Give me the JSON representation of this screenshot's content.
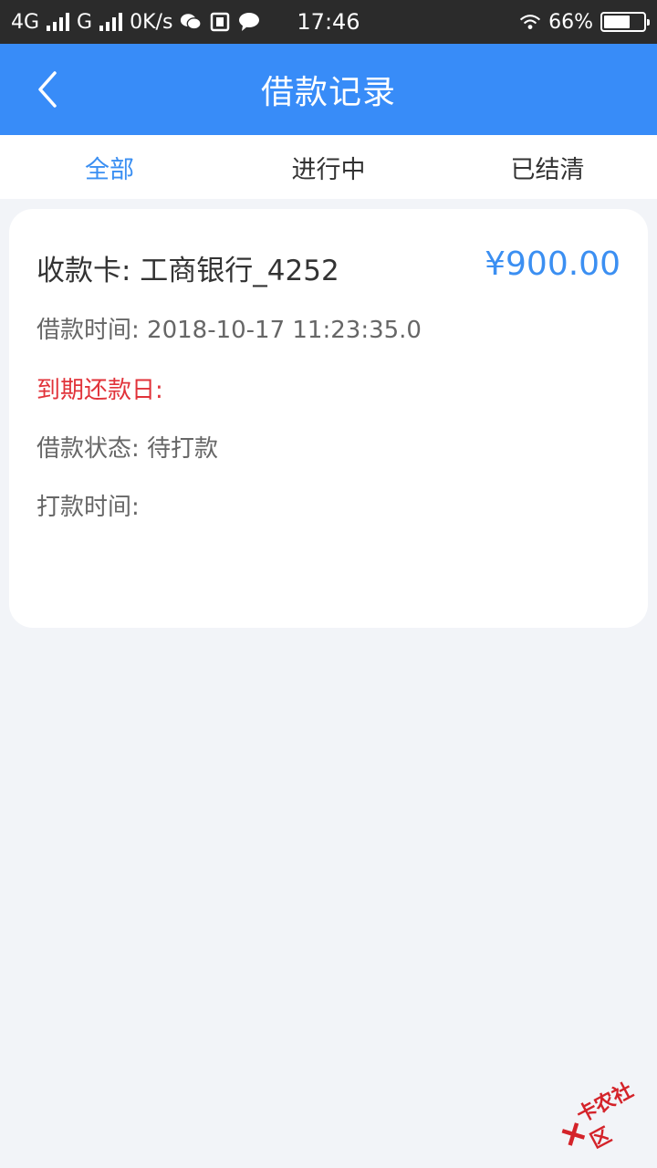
{
  "status_bar": {
    "network1": "4G",
    "network2": "G",
    "speed": "0K/s",
    "time": "17:46",
    "battery": "66%",
    "battery_level": 0.66
  },
  "header": {
    "title": "借款记录"
  },
  "tabs": [
    {
      "label": "全部",
      "active": true
    },
    {
      "label": "进行中",
      "active": false
    },
    {
      "label": "已结清",
      "active": false
    }
  ],
  "record": {
    "card": "收款卡: 工商银行_4252",
    "amount": "¥900.00",
    "borrow_time": "借款时间: 2018-10-17 11:23:35.0",
    "due_date": "到期还款日:",
    "status": "借款状态: 待打款",
    "pay_time": "打款时间:"
  },
  "watermark": {
    "text": "卡农社区"
  },
  "colors": {
    "accent": "#388cf8",
    "active_tab": "#3b8ff2",
    "warning": "#e1333a"
  }
}
